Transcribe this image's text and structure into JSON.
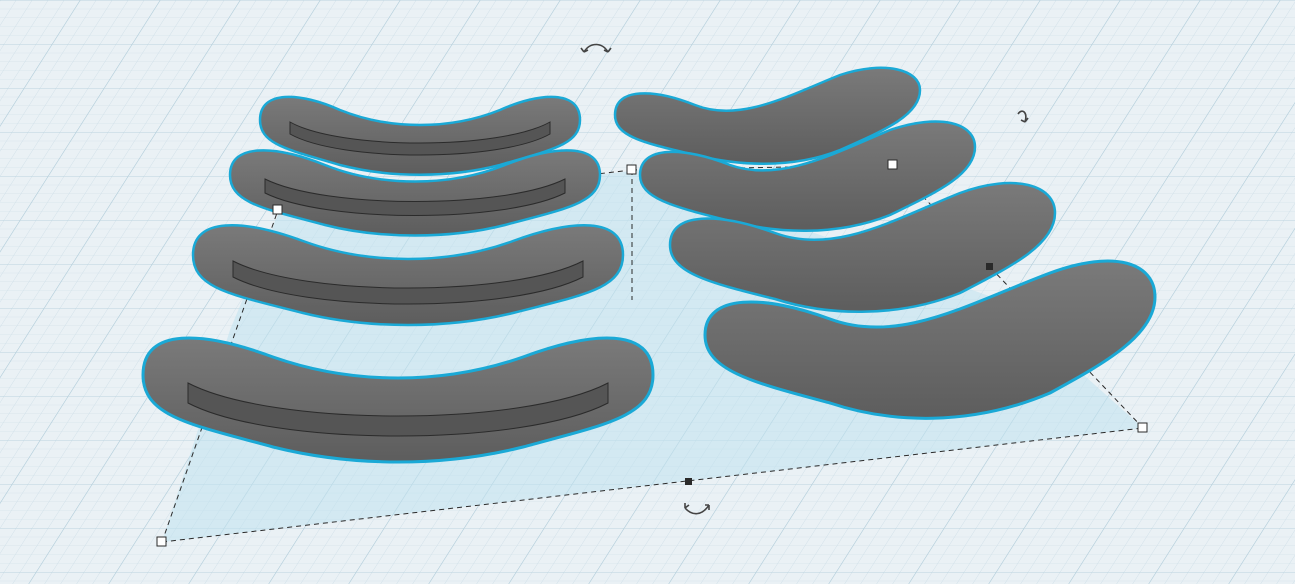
{
  "workplane": {
    "background_color": "#eaf1f5",
    "grid_minor_color": "#cddde6",
    "grid_major_color": "#aecbd9"
  },
  "selection": {
    "outline_color": "#1aa9d6",
    "box_color": "#2a2a2a",
    "shadow_color": "#bfe2ef",
    "handles": [
      "top-left-handle",
      "top-right-handle",
      "left-mid-handle",
      "right-mid-handle",
      "bottom-mid-handle",
      "bottom-left-handle",
      "bottom-right-handle"
    ],
    "rotate_handles": [
      "rotate-handle-top",
      "rotate-handle-right",
      "rotate-handle-bottom"
    ]
  },
  "shapes": {
    "fill_color": "#6e6e6e",
    "top_color": "#5a5a5a",
    "edge_color": "#2b2b2b",
    "items": [
      "arc-shape-1",
      "arc-shape-2",
      "arc-shape-3",
      "arc-shape-4",
      "arc-shape-5",
      "arc-shape-6",
      "arc-shape-7",
      "arc-shape-8"
    ]
  },
  "icons": {
    "rotate": "rotate-arrows-icon",
    "handle": "square-handle-icon"
  }
}
